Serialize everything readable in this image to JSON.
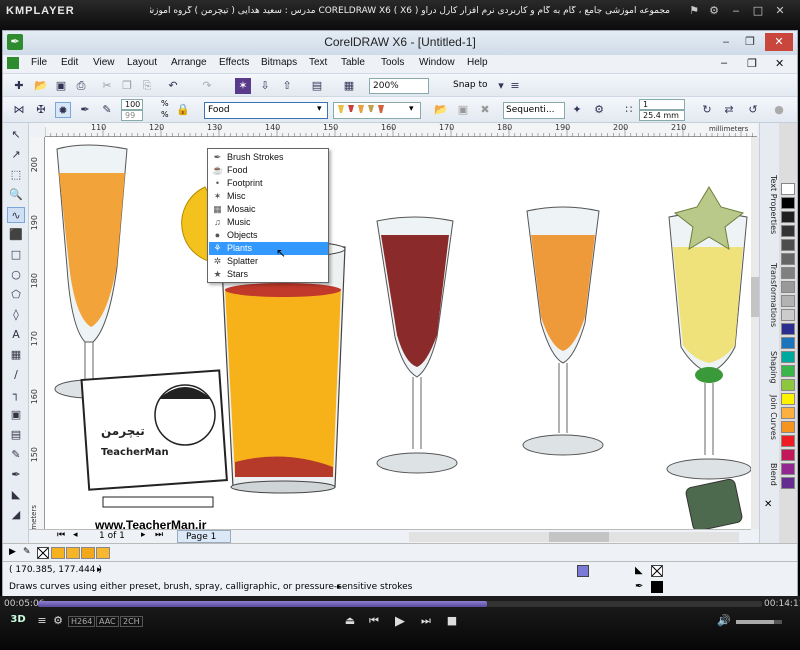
{
  "player": {
    "logo": "KMPLAYER",
    "title": "مجموعه آموزشی جامع ، گام به گام و کاربردی نرم افزار کارل دراو CORELDRAW X6 ( X6 ) مدرس : سعید هدایی ( تیچرمن ) گروه آموزشی پادشاه گرافیست ها",
    "time_elapsed": "00:05:06",
    "time_total": "00:14:11",
    "progress": 0.62,
    "badges": [
      "H264",
      "AAC",
      "2CH"
    ]
  },
  "app": {
    "title": "CorelDRAW X6 - [Untitled-1]",
    "menu": [
      "File",
      "Edit",
      "View",
      "Layout",
      "Arrange",
      "Effects",
      "Bitmaps",
      "Text",
      "Table",
      "Tools",
      "Window",
      "Help"
    ],
    "zoom": "200%",
    "snap_to": "Snap to",
    "brush_size": "100",
    "brush_smooth": "99",
    "category": "Food",
    "sequence": "Sequenti...",
    "spray_count": "1",
    "spray_size": "25.4 mm",
    "ruler_units": "millimeters",
    "ruler_h_ticks": [
      "110",
      "120",
      "130",
      "140",
      "150",
      "160",
      "170",
      "180",
      "190",
      "200",
      "210"
    ],
    "ruler_v_ticks": [
      "200",
      "190",
      "180",
      "170",
      "160",
      "150"
    ],
    "page_count": "1 of 1",
    "page_tab": "Page 1",
    "coords": "( 170.385, 177.444 )",
    "status_hint": "Draws curves using either preset, brush, spray, calligraphic, or pressure-sensitive strokes"
  },
  "dropdown": {
    "items": [
      {
        "label": "Brush Strokes",
        "icon": "brush-icon",
        "glyph": "✒"
      },
      {
        "label": "Food",
        "icon": "glass-icon",
        "glyph": "☕"
      },
      {
        "label": "Footprint",
        "icon": "footprint-icon",
        "glyph": "•"
      },
      {
        "label": "Misc",
        "icon": "misc-icon",
        "glyph": "✶"
      },
      {
        "label": "Mosaic",
        "icon": "mosaic-icon",
        "glyph": "▦"
      },
      {
        "label": "Music",
        "icon": "music-icon",
        "glyph": "♫"
      },
      {
        "label": "Objects",
        "icon": "objects-icon",
        "glyph": "●"
      },
      {
        "label": "Plants",
        "icon": "plant-icon",
        "glyph": "⚘"
      },
      {
        "label": "Splatter",
        "icon": "splatter-icon",
        "glyph": "✲"
      },
      {
        "label": "Stars",
        "icon": "star-icon",
        "glyph": "★"
      }
    ],
    "selected_index": 7
  },
  "docker_tabs": [
    "Text Properties",
    "Transformations",
    "Shaping",
    "Join Curves",
    "Blend"
  ],
  "palette": [
    "#ffffff",
    "#000000",
    "#1f1f1f",
    "#333333",
    "#4d4d4d",
    "#666666",
    "#808080",
    "#999999",
    "#b3b3b3",
    "#cccccc",
    "#2b2d8f",
    "#1b75bc",
    "#00a99d",
    "#39b54a",
    "#8dc63f",
    "#fff200",
    "#fbb040",
    "#f7941d",
    "#ed1c24",
    "#c2185b",
    "#92278f",
    "#662d91"
  ],
  "watermark": {
    "url": "www.TeacherMan.ir",
    "brand_en": "TeacherMan",
    "brand_fa": "تیچرمن"
  }
}
